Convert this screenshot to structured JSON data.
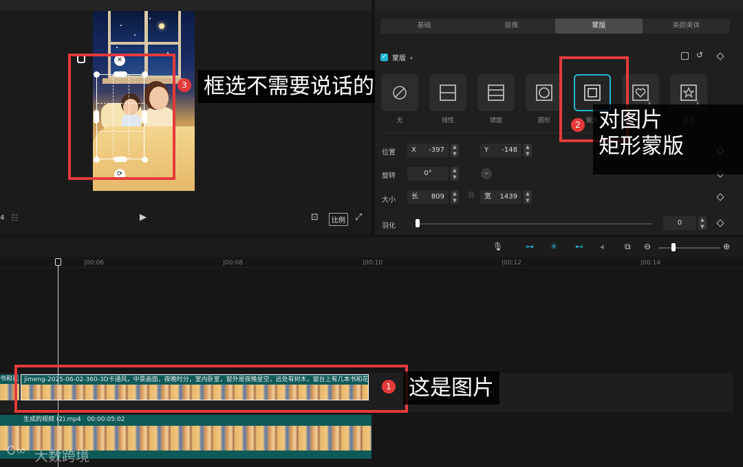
{
  "preview": {
    "frame_counter": "4",
    "ratio_label": "比例"
  },
  "inspector": {
    "tabs": [
      "基础",
      "抠像",
      "蒙版",
      "美颜美体"
    ],
    "active_tab": "蒙版",
    "section_title": "蒙版",
    "mask_options": [
      {
        "label": "无",
        "icon": "none-icon"
      },
      {
        "label": "线性",
        "icon": "linear-icon"
      },
      {
        "label": "镜面",
        "icon": "mirror-icon"
      },
      {
        "label": "圆形",
        "icon": "circle-icon"
      },
      {
        "label": "矩形",
        "icon": "rectangle-icon"
      },
      {
        "label": "爱心",
        "icon": "heart-icon"
      },
      {
        "label": "星形",
        "icon": "star-icon"
      }
    ],
    "selected_mask": "矩形",
    "props": {
      "position_label": "位置",
      "x_label": "X",
      "x_value": "-397",
      "y_label": "Y",
      "y_value": "-148",
      "rotate_label": "旋转",
      "rotate_value": "0°",
      "size_label": "大小",
      "length_label": "长",
      "length_value": "809",
      "width_label": "宽",
      "width_value": "1439",
      "feather_label": "羽化",
      "feather_value": "0"
    }
  },
  "timeline": {
    "ruler": [
      "|00:06",
      "|00:08",
      "|00:10",
      "|00:12",
      "|00:14"
    ],
    "image_clip_title": "jimeng-2025-06-02-360-3D卡通风，中景画面，夜晚时分，室内卧室，窗外是夜晚星空，远处有树木，窗台上有几本书和花",
    "prev_clip_title": "书和花",
    "video_clip_title": "生成的视频 (2).mp4",
    "video_clip_duration": "00:00:05:02"
  },
  "annotations": [
    {
      "num": "1",
      "text": "这是图片"
    },
    {
      "num": "2",
      "text": "对图片\n矩形蒙版"
    },
    {
      "num": "3",
      "text": "框选不需要说话的角色"
    }
  ],
  "watermark": "大数跨境",
  "colors": {
    "accent": "#21b7d6",
    "annotation_red": "#e53a3a",
    "clip_teal": "#0d5a57"
  }
}
